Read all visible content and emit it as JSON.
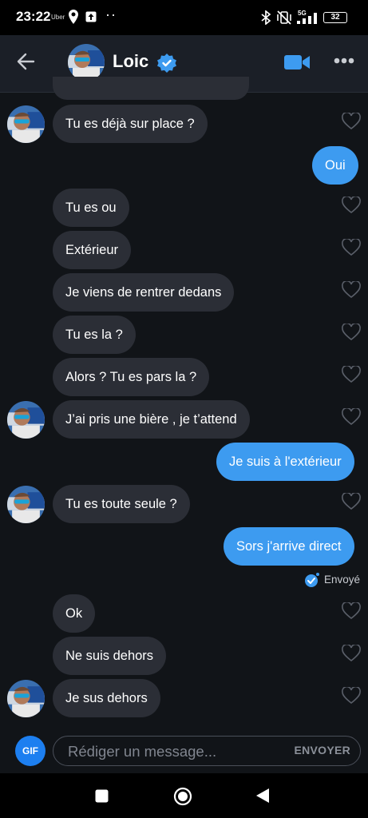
{
  "status_bar": {
    "time": "23:22",
    "carrier": "Uber",
    "network": "5G",
    "battery": "32"
  },
  "header": {
    "name": "Loic",
    "verified": true,
    "accent": "#3d9bf0"
  },
  "messages": [
    {
      "dir": "in",
      "text": "Tu es déjà sur place ?"
    },
    {
      "dir": "out",
      "text": "Oui"
    },
    {
      "dir": "in",
      "text": "Tu es ou"
    },
    {
      "dir": "in",
      "text": "Extérieur"
    },
    {
      "dir": "in",
      "text": "Je viens de rentrer dedans"
    },
    {
      "dir": "in",
      "text": "Tu es la ?"
    },
    {
      "dir": "in",
      "text": "Alors ? Tu es pars la ?"
    },
    {
      "dir": "in",
      "text": "J’ai pris une bière , je t’attend"
    },
    {
      "dir": "out",
      "text": "Je suis à l'extérieur"
    },
    {
      "dir": "in",
      "text": "Tu es toute seule ?"
    },
    {
      "dir": "out",
      "text": "Sors j'arrive direct"
    },
    {
      "dir": "in",
      "text": "Ok"
    },
    {
      "dir": "in",
      "text": "Ne suis dehors"
    },
    {
      "dir": "in",
      "text": "Je sus dehors"
    }
  ],
  "sent_status": "Envoyé",
  "composer": {
    "gif_label": "GIF",
    "placeholder": "Rédiger un message...",
    "send_label": "ENVOYER"
  },
  "icons": [
    "back-arrow-icon",
    "verified-badge-icon",
    "video-call-icon",
    "more-options-icon",
    "heart-icon",
    "gif-icon",
    "nav-recents-icon",
    "nav-home-icon",
    "nav-back-icon"
  ]
}
